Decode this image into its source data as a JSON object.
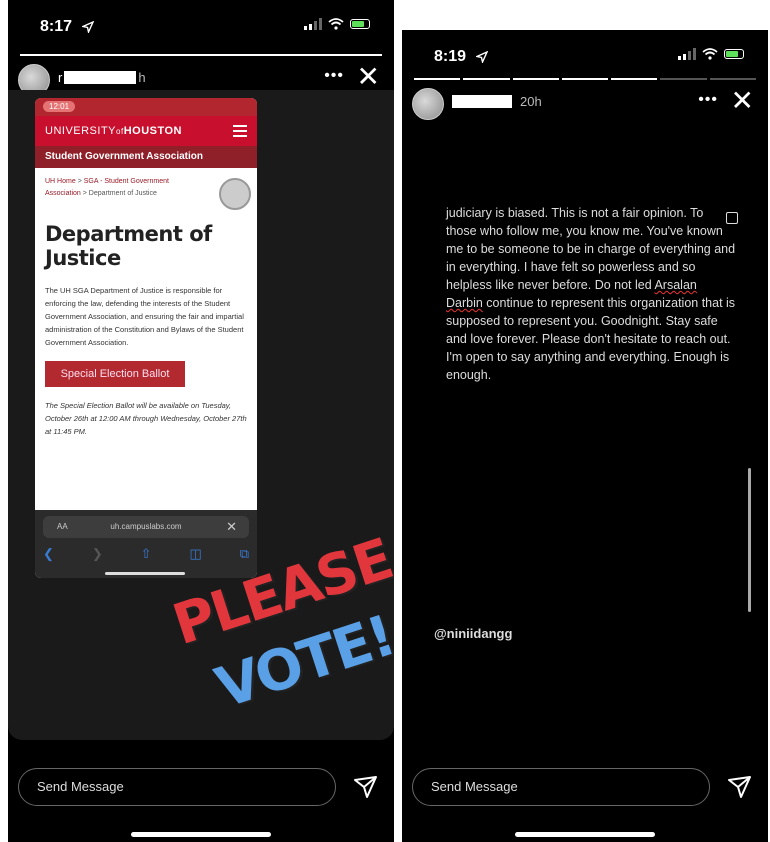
{
  "left_story": {
    "status_time": "8:17",
    "username_suffix": "h",
    "more_label": "•••",
    "close_label": "✕",
    "screenshot": {
      "phone_time": "12:01",
      "university_left": "UNIVERSITY",
      "university_of": "of",
      "university_right": "HOUSTON",
      "sga_title": "Student Government Association",
      "breadcrumb_home": "UH Home",
      "breadcrumb_sep": ">",
      "breadcrumb_sga": "SGA - Student Government Association",
      "breadcrumb_current": "Department of Justice",
      "page_title": "Department of Justice",
      "description": "The UH SGA Department of Justice is responsible for enforcing the law, defending the interests of the Student Government Association, and ensuring the fair and impartial administration of the Constitution and Bylaws of the Student Government Association.",
      "ballot_button": "Special Election Ballot",
      "ballot_note": "The Special Election Ballot will be available on Tuesday, October 26th at 12:00 AM through Wednesday, October 27th at 11:45 PM.",
      "url_aa": "AA",
      "url": "uh.campuslabs.com",
      "url_close": "✕"
    },
    "sticker_line1": "PLEASE",
    "sticker_line2": "VOTE!",
    "send_message_placeholder": "Send Message"
  },
  "right_story": {
    "status_time": "8:19",
    "posted_ago": "20h",
    "more_label": "•••",
    "close_label": "✕",
    "text_before": "judiciary is biased. This is not a fair opinion. To those who follow me, you know me. You've known me to be someone to be in charge of everything and in everything. I have felt so powerless and so helpless like never before. Do not led ",
    "name_first": "Arsalan",
    "name_last": "Darbin",
    "text_after": " continue to represent this organization that is supposed to represent you. Goodnight. Stay safe and love forever. Please don't hesitate to reach out. I'm open to say anything and everything. Enough is enough.",
    "mention": "@niniidangg",
    "send_message_placeholder": "Send Message"
  }
}
